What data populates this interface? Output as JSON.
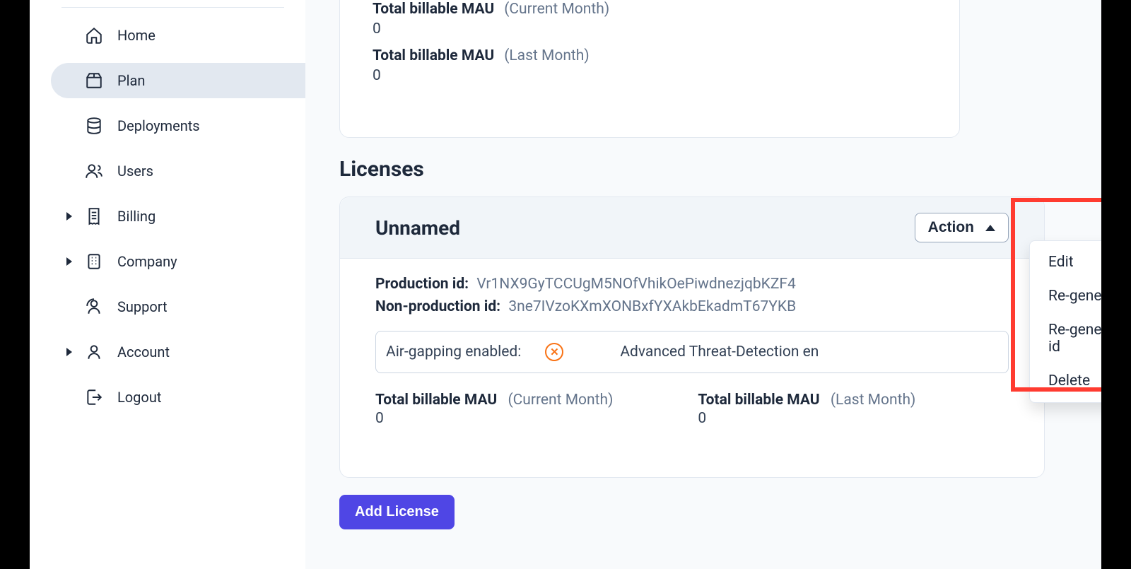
{
  "sidebar": {
    "items": [
      {
        "label": "Home",
        "icon": "home"
      },
      {
        "label": "Plan",
        "icon": "plan",
        "active": true
      },
      {
        "label": "Deployments",
        "icon": "deployments"
      },
      {
        "label": "Users",
        "icon": "users"
      },
      {
        "label": "Billing",
        "icon": "billing",
        "expandable": true
      },
      {
        "label": "Company",
        "icon": "company",
        "expandable": true
      },
      {
        "label": "Support",
        "icon": "support"
      },
      {
        "label": "Account",
        "icon": "account",
        "expandable": true
      },
      {
        "label": "Logout",
        "icon": "logout"
      }
    ]
  },
  "top_metrics": {
    "current": {
      "label": "Total billable MAU",
      "sub": "(Current Month)",
      "value": "0"
    },
    "last": {
      "label": "Total billable MAU",
      "sub": "(Last Month)",
      "value": "0"
    }
  },
  "licenses": {
    "section_title": "Licenses",
    "card": {
      "name": "Unnamed",
      "action_label": "Action",
      "production_id_label": "Production id:",
      "production_id": "Vr1NX9GyTCCUgM5NOfVhikOePiwdnezjqbKZF4",
      "nonproduction_id_label": "Non-production id:",
      "nonproduction_id": "3ne7IVzoKXmXONBxfYXAkbEkadmT67YKB",
      "air_gapping_label": "Air-gapping enabled:",
      "atd_label": "Advanced Threat-Detection en",
      "metrics": {
        "current": {
          "label": "Total billable MAU",
          "sub": "(Current Month)",
          "value": "0"
        },
        "last": {
          "label": "Total billable MAU",
          "sub": "(Last Month)",
          "value": "0"
        }
      }
    },
    "action_menu": [
      "Edit",
      "Re-generate production id",
      "Re-generate non-production id",
      "Delete"
    ],
    "add_button": "Add License"
  }
}
